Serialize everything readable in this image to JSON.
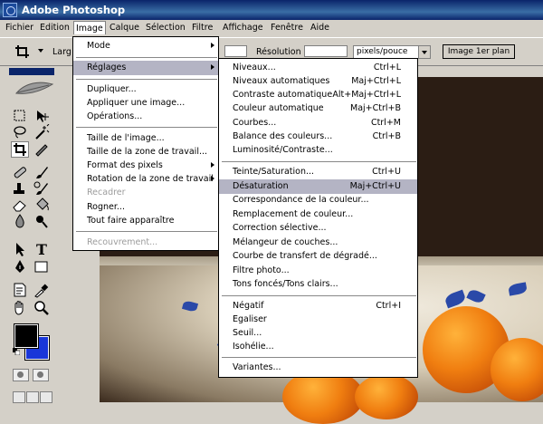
{
  "app": {
    "title": "Adobe Photoshop",
    "icon": "photoshop-app-icon"
  },
  "menubar": [
    "Fichier",
    "Edition",
    "Image",
    "Calque",
    "Sélection",
    "Filtre",
    "Affichage",
    "Fenêtre",
    "Aide"
  ],
  "options_bar": {
    "tool_icon": "crop-icon",
    "width_label": "Larg",
    "resolution_label": "Résolution :",
    "resolution_value": "",
    "resolution_unit": "pixels/pouce",
    "front_image_button": "Image 1er plan"
  },
  "image_menu": {
    "items": [
      {
        "label": "Mode",
        "submenu": true
      },
      {
        "label": "Réglages",
        "submenu": true,
        "highlighted": true
      },
      {
        "label": "Dupliquer..."
      },
      {
        "label": "Appliquer une image..."
      },
      {
        "label": "Opérations..."
      },
      {
        "label": "Taille de l'image..."
      },
      {
        "label": "Taille de la zone de travail..."
      },
      {
        "label": "Format des pixels",
        "submenu": true
      },
      {
        "label": "Rotation de la zone de travail",
        "submenu": true
      },
      {
        "label": "Recadrer",
        "disabled": true
      },
      {
        "label": "Rogner..."
      },
      {
        "label": "Tout faire apparaître"
      },
      {
        "label": "Recouvrement...",
        "disabled": true
      }
    ]
  },
  "adjustments_menu": {
    "items": [
      {
        "label": "Niveaux...",
        "shortcut": "Ctrl+L"
      },
      {
        "label": "Niveaux automatiques",
        "shortcut": "Maj+Ctrl+L"
      },
      {
        "label": "Contraste automatique",
        "shortcut": "Alt+Maj+Ctrl+L"
      },
      {
        "label": "Couleur automatique",
        "shortcut": "Maj+Ctrl+B"
      },
      {
        "label": "Courbes...",
        "shortcut": "Ctrl+M"
      },
      {
        "label": "Balance des couleurs...",
        "shortcut": "Ctrl+B"
      },
      {
        "label": "Luminosité/Contraste...",
        "shortcut": ""
      },
      {
        "label": "Teinte/Saturation...",
        "shortcut": "Ctrl+U"
      },
      {
        "label": "Désaturation",
        "shortcut": "Maj+Ctrl+U",
        "highlighted": true
      },
      {
        "label": "Correspondance de la couleur...",
        "shortcut": ""
      },
      {
        "label": "Remplacement de couleur...",
        "shortcut": ""
      },
      {
        "label": "Correction sélective...",
        "shortcut": ""
      },
      {
        "label": "Mélangeur de couches...",
        "shortcut": ""
      },
      {
        "label": "Courbe de transfert de dégradé...",
        "shortcut": ""
      },
      {
        "label": "Filtre photo...",
        "shortcut": ""
      },
      {
        "label": "Tons foncés/Tons clairs...",
        "shortcut": ""
      },
      {
        "label": "Négatif",
        "shortcut": "Ctrl+I"
      },
      {
        "label": "Egaliser",
        "shortcut": ""
      },
      {
        "label": "Seuil...",
        "shortcut": ""
      },
      {
        "label": "Isohélie...",
        "shortcut": ""
      },
      {
        "label": "Variantes...",
        "shortcut": ""
      }
    ]
  },
  "toolbox": {
    "tools": [
      "marquee-icon",
      "move-icon",
      "lasso-icon",
      "magic-wand-icon",
      "crop-icon",
      "slice-icon",
      "healing-brush-icon",
      "brush-icon",
      "clone-stamp-icon",
      "history-brush-icon",
      "eraser-icon",
      "paint-bucket-icon",
      "blur-icon",
      "dodge-icon",
      "path-select-icon",
      "type-icon",
      "pen-icon",
      "rectangle-icon",
      "notes-icon",
      "eyedropper-icon",
      "hand-icon",
      "zoom-icon"
    ],
    "foreground_color": "#000000",
    "background_color": "#1936d9"
  }
}
